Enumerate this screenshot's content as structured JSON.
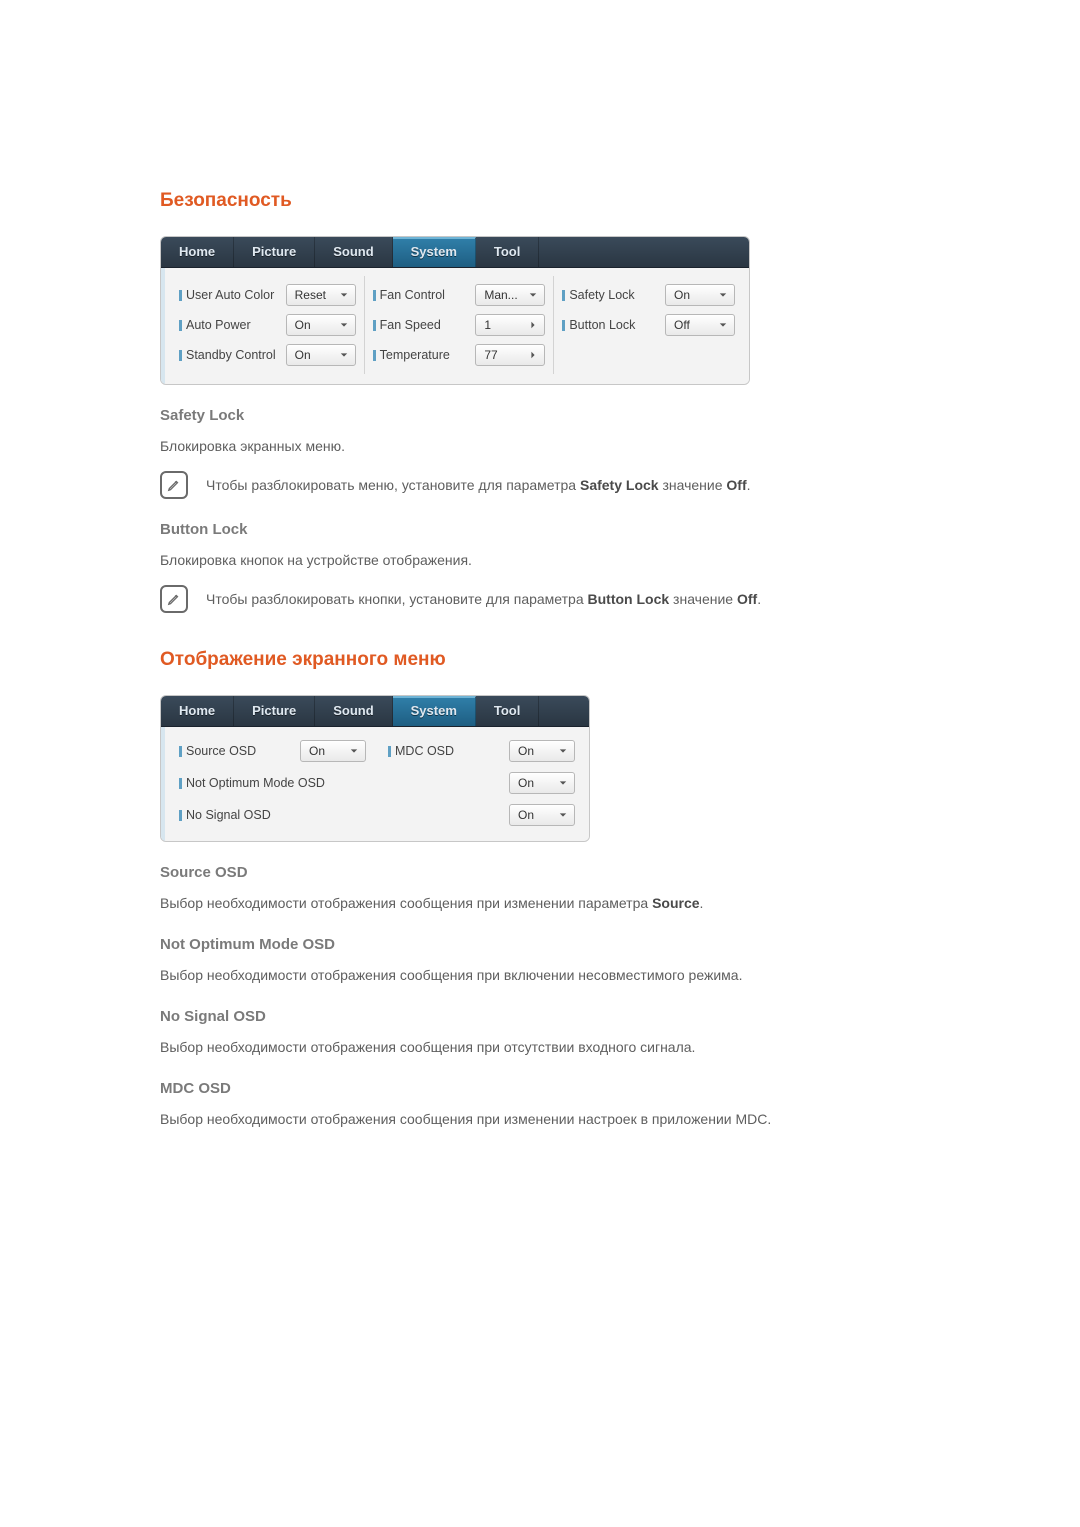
{
  "sections": {
    "security": {
      "title": "Безопасность",
      "safety_lock": {
        "heading": "Safety Lock",
        "desc": "Блокировка экранных меню.",
        "note_pre": "Чтобы разблокировать меню, установите для параметра ",
        "note_bold1": "Safety Lock",
        "note_mid": " значение ",
        "note_bold2": "Off",
        "note_post": "."
      },
      "button_lock": {
        "heading": "Button Lock",
        "desc": "Блокировка кнопок на устройстве отображения.",
        "note_pre": "Чтобы разблокировать кнопки, установите для параметра ",
        "note_bold1": "Button Lock",
        "note_mid": " значение ",
        "note_bold2": "Off",
        "note_post": "."
      }
    },
    "osd": {
      "title": "Отображение экранного меню",
      "source_osd": {
        "heading": "Source OSD",
        "desc_pre": "Выбор необходимости отображения сообщения при изменении параметра ",
        "desc_bold": "Source",
        "desc_post": "."
      },
      "not_optimum": {
        "heading": "Not Optimum Mode OSD",
        "desc": "Выбор необходимости отображения сообщения при включении несовместимого режима."
      },
      "no_signal": {
        "heading": "No Signal OSD",
        "desc": "Выбор необходимости отображения сообщения при отсутствии входного сигнала."
      },
      "mdc_osd": {
        "heading": "MDC OSD",
        "desc": "Выбор необходимости отображения сообщения при изменении настроек в приложении MDC."
      }
    }
  },
  "panel1": {
    "tabs": {
      "home": "Home",
      "picture": "Picture",
      "sound": "Sound",
      "system": "System",
      "tool": "Tool"
    },
    "col1": {
      "user_auto_color": {
        "label": "User Auto Color",
        "value": "Reset"
      },
      "auto_power": {
        "label": "Auto Power",
        "value": "On"
      },
      "standby_control": {
        "label": "Standby Control",
        "value": "On"
      }
    },
    "col2": {
      "fan_control": {
        "label": "Fan Control",
        "value": "Man..."
      },
      "fan_speed": {
        "label": "Fan Speed",
        "value": "1"
      },
      "temperature": {
        "label": "Temperature",
        "value": "77"
      }
    },
    "col3": {
      "safety_lock": {
        "label": "Safety Lock",
        "value": "On"
      },
      "button_lock": {
        "label": "Button Lock",
        "value": "Off"
      }
    }
  },
  "panel2": {
    "tabs": {
      "home": "Home",
      "picture": "Picture",
      "sound": "Sound",
      "system": "System",
      "tool": "Tool"
    },
    "row1": {
      "source_osd": {
        "label": "Source OSD",
        "value": "On"
      },
      "mdc_osd": {
        "label": "MDC OSD",
        "value": "On"
      }
    },
    "row2": {
      "not_optimum": {
        "label": "Not Optimum Mode OSD",
        "value": "On"
      }
    },
    "row3": {
      "no_signal": {
        "label": "No Signal OSD",
        "value": "On"
      }
    }
  }
}
